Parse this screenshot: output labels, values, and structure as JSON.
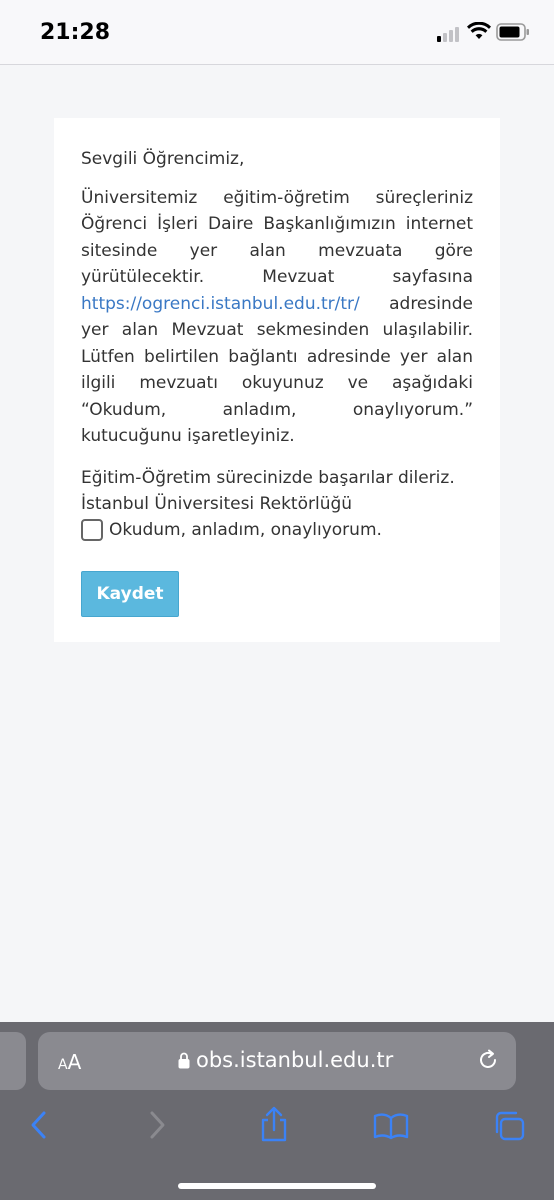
{
  "status_bar": {
    "time": "21:28",
    "signal_bars_active": 1,
    "signal_bars_total": 4
  },
  "card": {
    "greeting": "Sevgili Öğrencimiz,",
    "paragraph_before_link": "Üniversitemiz eğitim-öğretim süreçleriniz Öğrenci İşleri Daire Başkanlığımızın internet sitesinde yer alan mevzuata göre yürütülecektir. Mevzuat sayfasına ",
    "link_text": "https://ogrenci.istanbul.edu.tr/tr/",
    "paragraph_after_link": " adresinde yer alan Mevzuat sekmesinden ulaşılabilir. Lütfen belirtilen bağlantı adresinde yer alan ilgili mevzuatı okuyunuz ve aşağıdaki “Okudum, anladım, onaylıyorum.” kutucuğunu işaretleyiniz.",
    "closing_line1": "Eğitim-Öğretim sürecinizde başarılar dileriz.",
    "closing_line2": "İstanbul Üniversitesi Rektörlüğü",
    "checkbox_label": "Okudum, anladım, onaylıyorum.",
    "checkbox_checked": false,
    "save_button_label": "Kaydet"
  },
  "browser": {
    "aa_small": "A",
    "aa_big": "A",
    "url": "obs.istanbul.edu.tr"
  },
  "colors": {
    "link": "#3a78c4",
    "button": "#5bb8de",
    "toolbar_icons": "#3b82f6"
  },
  "icons": [
    "wifi-icon",
    "battery-icon",
    "lock-icon",
    "reload-icon",
    "back-icon",
    "forward-icon",
    "share-icon",
    "bookmarks-icon",
    "tabs-icon"
  ]
}
